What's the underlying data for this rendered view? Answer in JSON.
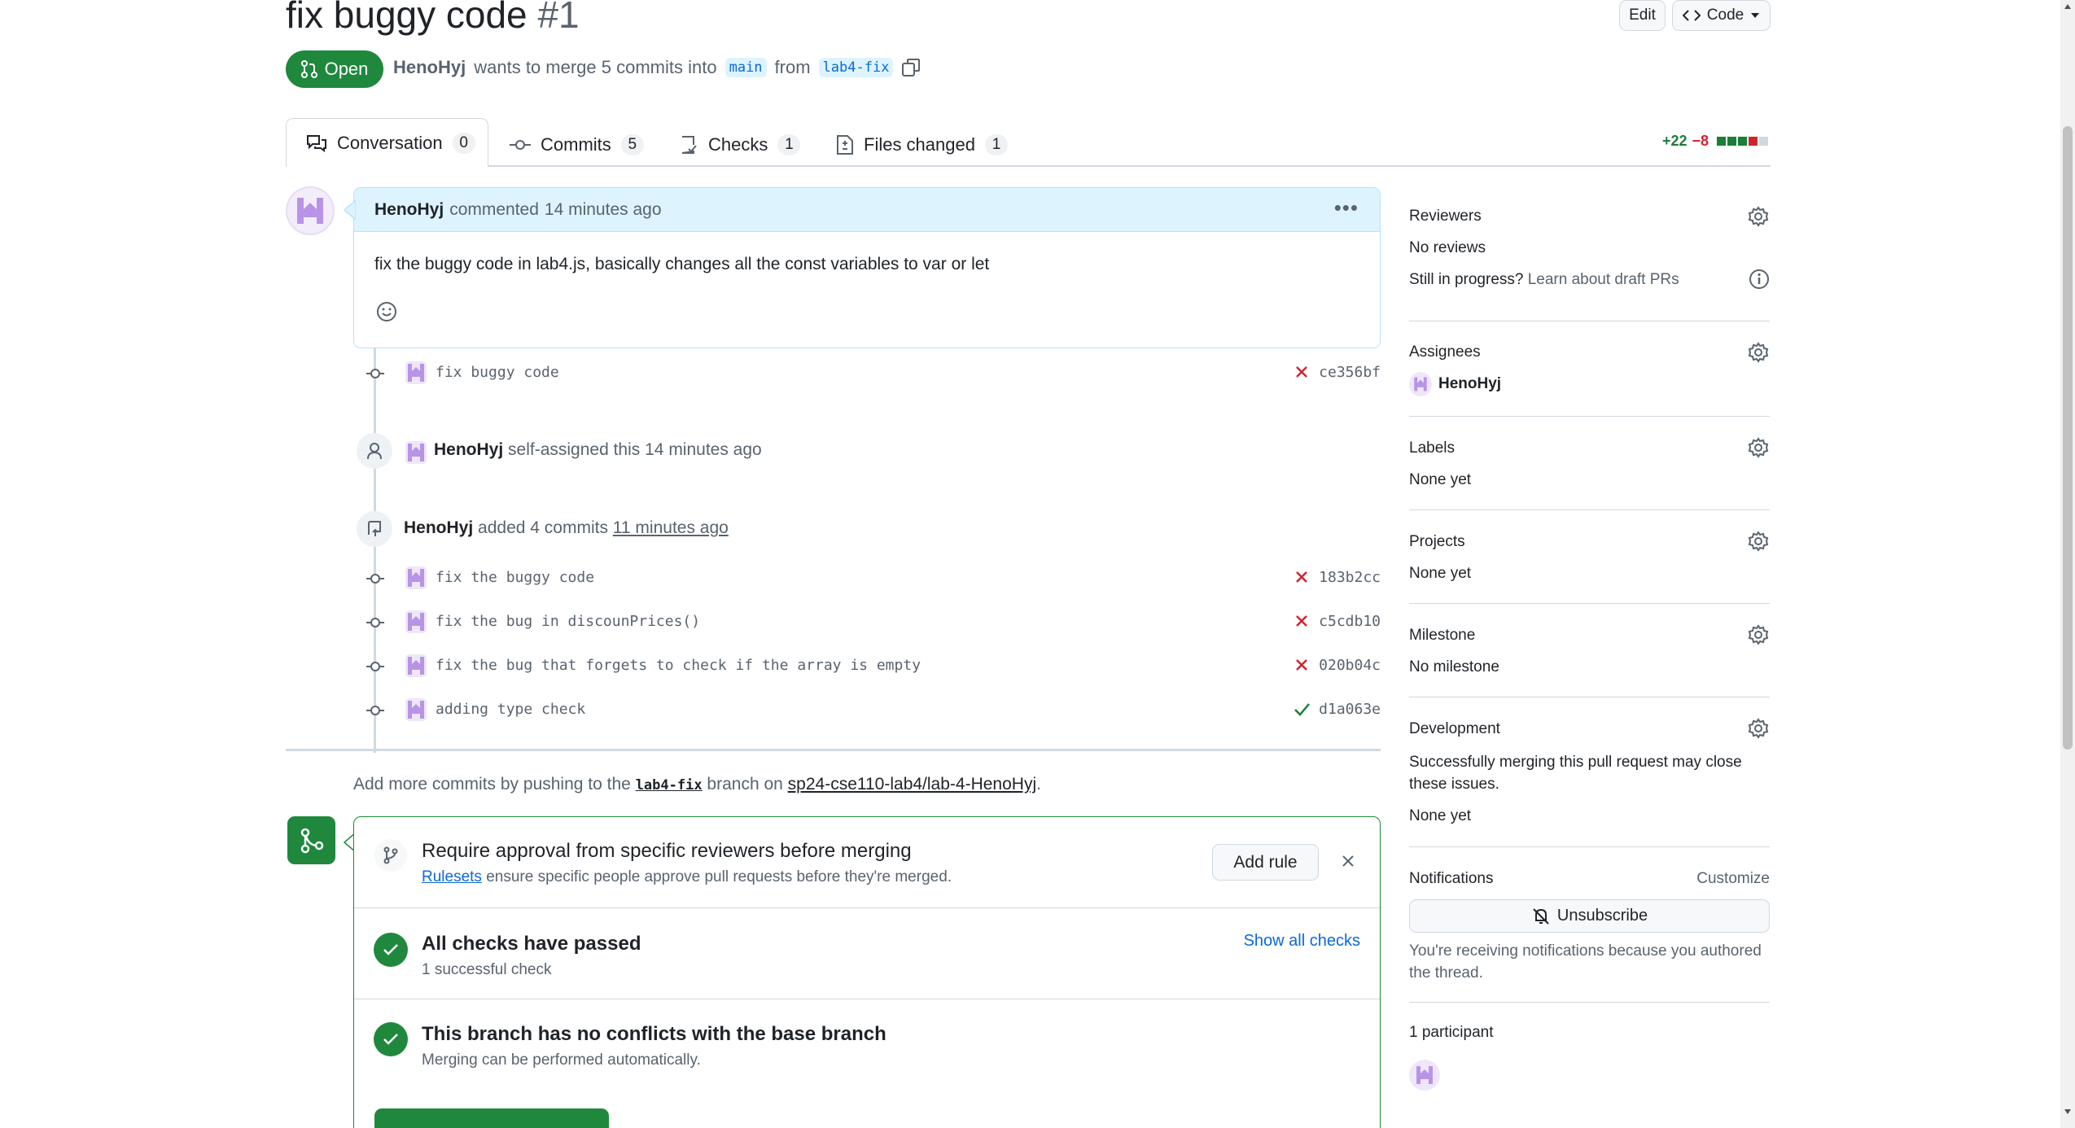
{
  "pr": {
    "title": "fix buggy code",
    "number": "#1",
    "state": "Open",
    "author": "HenoHyj",
    "merge_text": "wants to merge 5 commits into",
    "base_branch": "main",
    "from_text": "from",
    "head_branch": "lab4-fix"
  },
  "header_buttons": {
    "edit": "Edit",
    "code": "Code"
  },
  "tabs": [
    {
      "label": "Conversation",
      "count": "0"
    },
    {
      "label": "Commits",
      "count": "5"
    },
    {
      "label": "Checks",
      "count": "1"
    },
    {
      "label": "Files changed",
      "count": "1"
    }
  ],
  "diffstat": {
    "additions": "+22",
    "deletions": "−8"
  },
  "comment": {
    "author": "HenoHyj",
    "action": "commented",
    "time": "14 minutes ago",
    "body": "fix the buggy code in lab4.js, basically changes all the const variables to var or let"
  },
  "first_commit": {
    "message": "fix buggy code",
    "sha": "ce356bf",
    "status": "fail"
  },
  "assign_event": {
    "author": "HenoHyj",
    "action": "self-assigned this",
    "time": "14 minutes ago"
  },
  "added_event": {
    "author": "HenoHyj",
    "action": "added 4 commits",
    "time": "11 minutes ago"
  },
  "commits": [
    {
      "message": "fix the buggy code",
      "sha": "183b2cc",
      "status": "fail"
    },
    {
      "message": "fix the bug in discounPrices()",
      "sha": "c5cdb10",
      "status": "fail"
    },
    {
      "message": "fix the bug that forgets to check if the array is empty",
      "sha": "020b04c",
      "status": "fail"
    },
    {
      "message": "adding type check",
      "sha": "d1a063e",
      "status": "pass"
    }
  ],
  "push_hint": {
    "prefix": "Add more commits by pushing to the",
    "branch": "lab4-fix",
    "middle": "branch on",
    "repo": "sp24-cse110-lab4/lab-4-HenoHyj",
    "suffix": "."
  },
  "merge_box": {
    "rule_title": "Require approval from specific reviewers before merging",
    "rule_link": "Rulesets",
    "rule_desc": "ensure specific people approve pull requests before they're merged.",
    "add_rule": "Add rule",
    "checks_title": "All checks have passed",
    "checks_sub": "1 successful check",
    "show_checks": "Show all checks",
    "conflict_title": "This branch has no conflicts with the base branch",
    "conflict_sub": "Merging can be performed automatically."
  },
  "sidebar": {
    "reviewers": {
      "title": "Reviewers",
      "value": "No reviews",
      "draft_prefix": "Still in progress?",
      "draft_link": "Learn about draft PRs"
    },
    "assignees": {
      "title": "Assignees",
      "value": "HenoHyj"
    },
    "labels": {
      "title": "Labels",
      "value": "None yet"
    },
    "projects": {
      "title": "Projects",
      "value": "None yet"
    },
    "milestone": {
      "title": "Milestone",
      "value": "No milestone"
    },
    "development": {
      "title": "Development",
      "desc": "Successfully merging this pull request may close these issues.",
      "value": "None yet"
    },
    "notifications": {
      "title": "Notifications",
      "customize": "Customize",
      "button": "Unsubscribe",
      "reason": "You're receiving notifications because you authored the thread."
    },
    "participants": {
      "title": "1 participant"
    }
  },
  "colors": {
    "green": "#1f883d",
    "red": "#d1242f",
    "link": "#0969da",
    "border": "#d1d9e0",
    "comment_header": "#ddf4ff"
  }
}
